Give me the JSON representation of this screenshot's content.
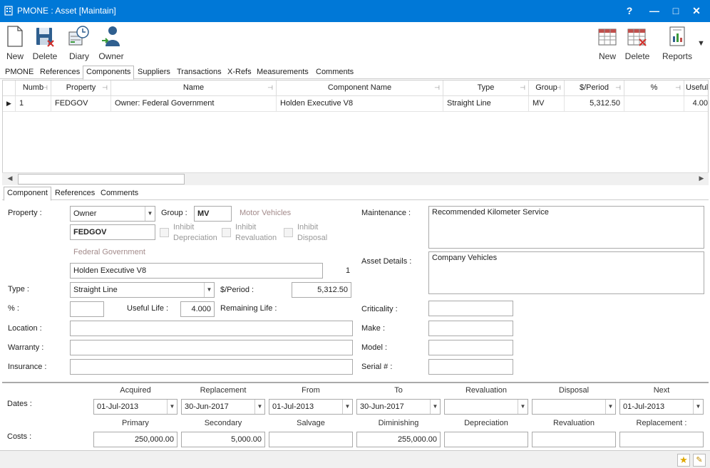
{
  "window": {
    "title": "PMONE : Asset [Maintain]",
    "help": "?",
    "minimize": "—",
    "maximize": "□",
    "close": "✕"
  },
  "toolbar": {
    "new": "New",
    "delete": "Delete",
    "diary": "Diary",
    "owner": "Owner",
    "comp_new": "New",
    "comp_delete": "Delete",
    "reports": "Reports"
  },
  "main_tabs": [
    "PMONE",
    "References",
    "Components",
    "Suppliers",
    "Transactions",
    "X-Refs",
    "Measurements",
    "Comments"
  ],
  "grid": {
    "columns": [
      "Numb",
      "Property",
      "Name",
      "Component Name",
      "Type",
      "Group",
      "$/Period",
      "%",
      "Useful"
    ],
    "rows": [
      {
        "numb": "1",
        "property": "FEDGOV",
        "name": "Owner: Federal Government",
        "component": "Holden Executive V8",
        "type": "Straight Line",
        "group": "MV",
        "period": "5,312.50",
        "pct": "",
        "useful": "4.00"
      }
    ]
  },
  "sub_tabs": [
    "Component",
    "References",
    "Comments"
  ],
  "form": {
    "property_label": "Property :",
    "property_type": "Owner",
    "property_code": "FEDGOV",
    "property_name": "Federal Government",
    "group_label": "Group :",
    "group_code": "MV",
    "group_name": "Motor Vehicles",
    "inhibit_dep": "Inhibit Depreciation",
    "inhibit_dep_1": "Inhibit",
    "inhibit_dep_2": "Depreciation",
    "inhibit_rev_1": "Inhibit",
    "inhibit_rev_2": "Revaluation",
    "inhibit_disp_1": "Inhibit",
    "inhibit_disp_2": "Disposal",
    "component_name": "Holden Executive V8",
    "component_number": "1",
    "type_label": "Type :",
    "type_value": "Straight Line",
    "period_label": "$/Period :",
    "period_value": "5,312.50",
    "pct_label": "% :",
    "pct_value": "",
    "useful_label": "Useful Life :",
    "useful_value": "4.000",
    "remaining_label": "Remaining Life :",
    "location_label": "Location :",
    "warranty_label": "Warranty :",
    "insurance_label": "Insurance :",
    "maintenance_label": "Maintenance :",
    "maintenance_value": "Recommended Kilometer Service",
    "asset_details_label": "Asset Details :",
    "asset_details_value": "Company Vehicles",
    "criticality_label": "Criticality :",
    "make_label": "Make :",
    "model_label": "Model :",
    "serial_label": "Serial # :"
  },
  "dates": {
    "row_label": "Dates :",
    "headers": [
      "Acquired",
      "Replacement",
      "From",
      "To",
      "Revaluation",
      "Disposal",
      "Next"
    ],
    "values": [
      "01-Jul-2013",
      "30-Jun-2017",
      "01-Jul-2013",
      "30-Jun-2017",
      "",
      "",
      "01-Jul-2013"
    ]
  },
  "costs": {
    "row_label": "Costs :",
    "headers": [
      "Primary",
      "Secondary",
      "Salvage",
      "Diminishing",
      "Depreciation",
      "Revaluation",
      "Replacement :"
    ],
    "values": [
      "250,000.00",
      "5,000.00",
      "",
      "255,000.00",
      "",
      "",
      ""
    ]
  },
  "colors": {
    "titlebar": "#0078d7",
    "muted_link": "#a38b8b"
  }
}
